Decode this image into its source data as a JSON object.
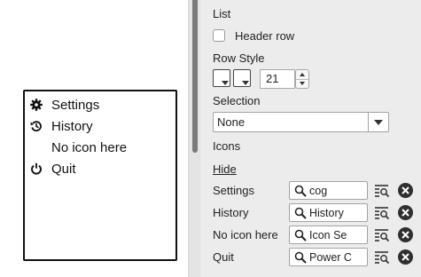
{
  "sketch": {
    "rows": [
      {
        "label": "Settings",
        "icon": "cog-icon"
      },
      {
        "label": "History",
        "icon": "history-icon"
      },
      {
        "label": "No icon here",
        "icon": ""
      },
      {
        "label": "Quit",
        "icon": "power-icon"
      }
    ]
  },
  "panel": {
    "list_heading": "List",
    "header_row_label": "Header row",
    "header_row_checked": false,
    "row_style_heading": "Row Style",
    "row_height_value": "21",
    "selection_heading": "Selection",
    "selection_value": "None",
    "icons_heading": "Icons",
    "hide_link": "Hide",
    "icon_rows": [
      {
        "label": "Settings",
        "icon_value": "cog"
      },
      {
        "label": "History",
        "icon_value": "History"
      },
      {
        "label": "No icon here",
        "icon_value": "Icon Se"
      },
      {
        "label": "Quit",
        "icon_value": "Power C"
      }
    ]
  },
  "colors": {
    "panel_bg": "#ececec",
    "sketch_border": "#111111",
    "scroll_thumb": "#7a7a7a"
  }
}
